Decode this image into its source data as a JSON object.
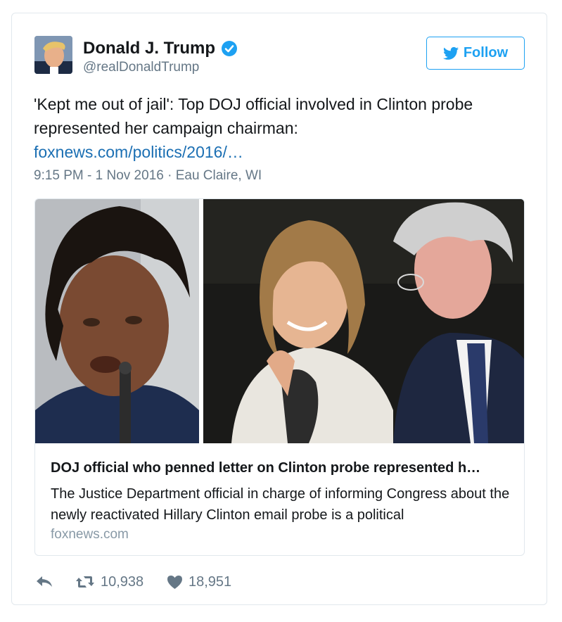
{
  "author": {
    "display_name": "Donald J. Trump",
    "handle": "@realDonaldTrump",
    "verified": true,
    "avatar_icon": "profile-photo"
  },
  "follow_button": {
    "label": "Follow",
    "icon": "twitter-bird-icon"
  },
  "tweet": {
    "text": "'Kept me out of jail': Top DOJ official involved in Clinton probe represented her campaign chairman:",
    "link_text": "foxnews.com/politics/2016/…",
    "timestamp": "9:15 PM - 1 Nov 2016 · Eau Claire, WI"
  },
  "link_card": {
    "title": "DOJ official who penned letter on Clinton probe represented h…",
    "description": "The Justice Department official in charge of informing Congress about the newly reactivated Hillary Clinton email probe is a political",
    "domain": "foxnews.com"
  },
  "actions": {
    "reply_icon": "reply-arrow-icon",
    "retweet_icon": "retweet-icon",
    "retweet_count": "10,938",
    "like_icon": "heart-icon",
    "like_count": "18,951"
  },
  "colors": {
    "accent": "#1da1f2",
    "link": "#1b6fb3",
    "secondary_text": "#657786",
    "border": "#e1e8ed"
  }
}
